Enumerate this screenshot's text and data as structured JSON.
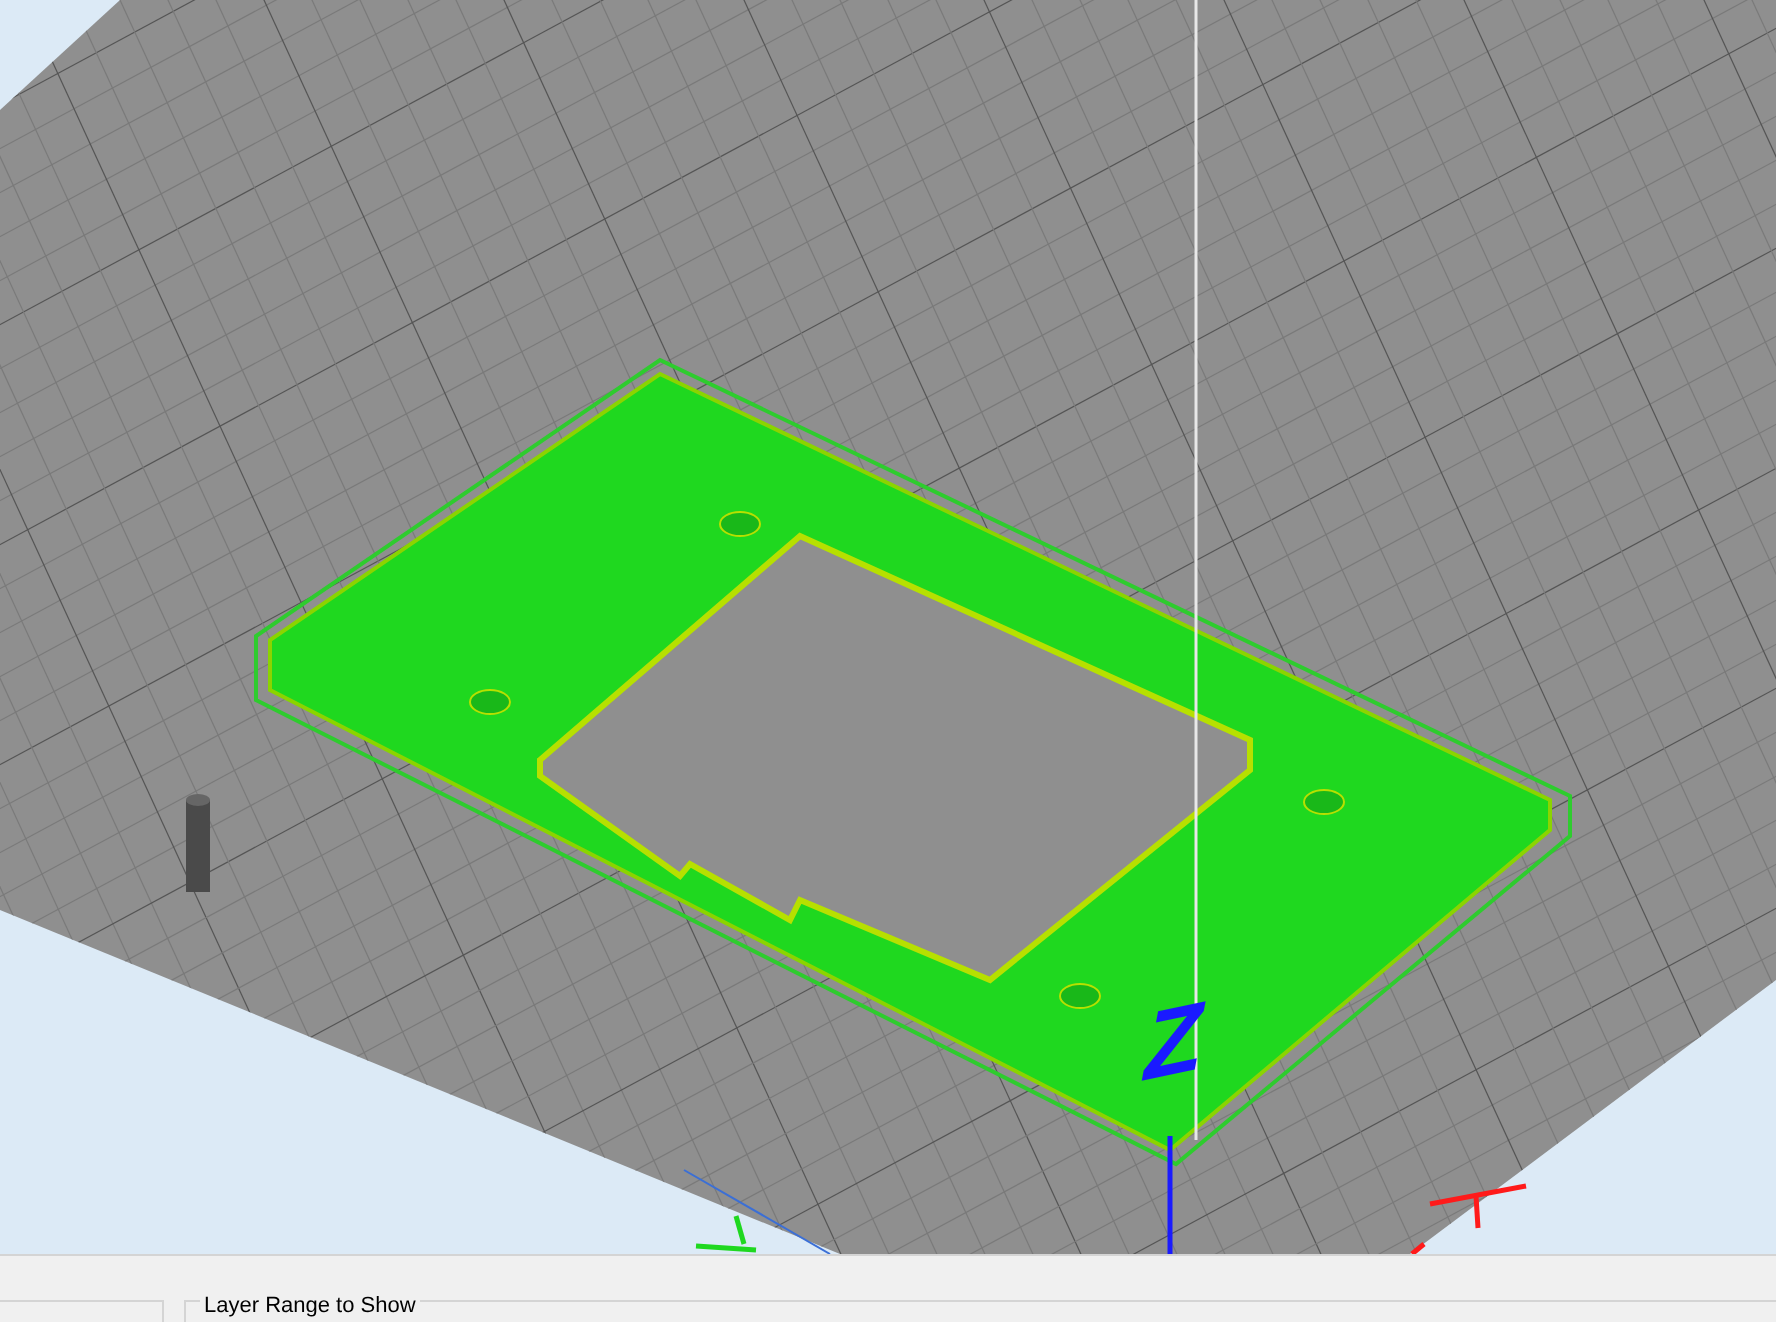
{
  "viewport": {
    "axis_label": "Z"
  },
  "bottom_panel": {
    "group_title": "Layer Range to Show"
  }
}
